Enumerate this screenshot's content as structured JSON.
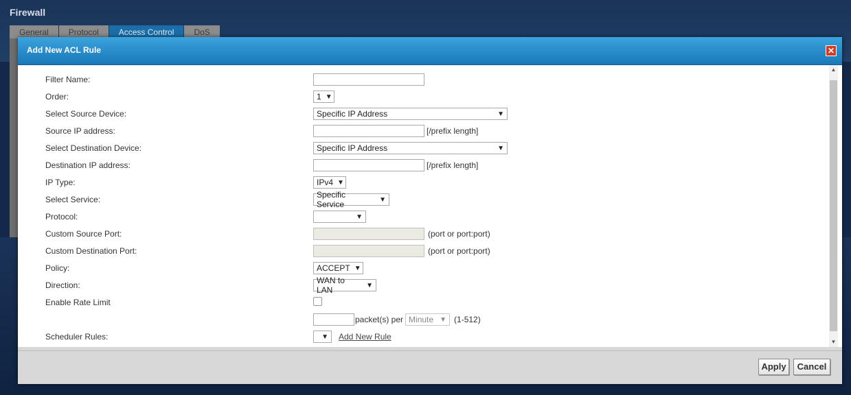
{
  "background": {
    "title": "Firewall",
    "tabs": [
      {
        "label": "General"
      },
      {
        "label": "Protocol"
      },
      {
        "label": "Access Control"
      },
      {
        "label": "DoS"
      }
    ]
  },
  "dialog": {
    "title": "Add New ACL Rule",
    "close_icon": "close-icon",
    "fields": {
      "filter_name": {
        "label": "Filter Name:",
        "value": ""
      },
      "order": {
        "label": "Order:",
        "value": "1"
      },
      "source_device": {
        "label": "Select Source Device:",
        "value": "Specific IP Address"
      },
      "source_ip": {
        "label": "Source IP address:",
        "value": "",
        "hint": "[/prefix length]"
      },
      "dest_device": {
        "label": "Select Destination Device:",
        "value": "Specific IP Address"
      },
      "dest_ip": {
        "label": "Destination IP address:",
        "value": "",
        "hint": "[/prefix length]"
      },
      "ip_type": {
        "label": "IP Type:",
        "value": "IPv4"
      },
      "service": {
        "label": "Select Service:",
        "value": "Specific Service"
      },
      "protocol": {
        "label": "Protocol:",
        "value": ""
      },
      "custom_source_port": {
        "label": "Custom Source Port:",
        "value": "",
        "hint": "(port or port:port)"
      },
      "custom_dest_port": {
        "label": "Custom Destination Port:",
        "value": "",
        "hint": "(port or port:port)"
      },
      "policy": {
        "label": "Policy:",
        "value": "ACCEPT"
      },
      "direction": {
        "label": "Direction:",
        "value": "WAN to LAN"
      },
      "rate_limit": {
        "label": "Enable Rate Limit",
        "checked": false
      },
      "rate": {
        "value": "",
        "unit_text": "packet(s) per",
        "period": "Minute",
        "range": "(1-512)"
      },
      "scheduler": {
        "label": "Scheduler Rules:",
        "value": "",
        "link": "Add New Rule"
      }
    },
    "buttons": {
      "apply": "Apply",
      "cancel": "Cancel"
    }
  }
}
